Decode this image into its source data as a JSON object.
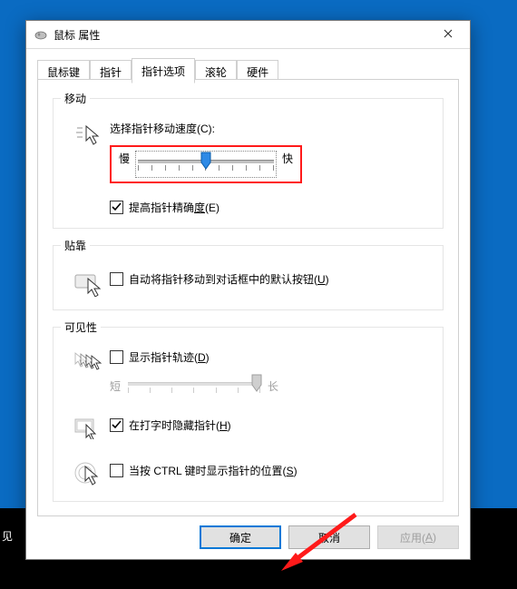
{
  "window": {
    "title": "鼠标 属性"
  },
  "tabs": [
    {
      "id": "buttons",
      "label": "鼠标键"
    },
    {
      "id": "pointer",
      "label": "指针"
    },
    {
      "id": "options",
      "label": "指针选项",
      "active": true
    },
    {
      "id": "wheel",
      "label": "滚轮"
    },
    {
      "id": "hardware",
      "label": "硬件"
    }
  ],
  "groups": {
    "motion": {
      "legend": "移动",
      "speed_label": "选择指针移动速度(C):",
      "slow": "慢",
      "fast": "快",
      "speed_value": 6,
      "speed_min": 1,
      "speed_max": 11,
      "enhance": {
        "checked": true,
        "label": "提高指针精确度(E)"
      }
    },
    "snap": {
      "legend": "贴靠",
      "snap": {
        "checked": false,
        "label": "自动将指针移动到对话框中的默认按钮(U)"
      }
    },
    "visibility": {
      "legend": "可见性",
      "trails": {
        "checked": false,
        "label": "显示指针轨迹(D)"
      },
      "trails_short": "短",
      "trails_long": "长",
      "trails_enabled": false,
      "hide_typing": {
        "checked": true,
        "label": "在打字时隐藏指针(H)"
      },
      "ctrl_locate": {
        "checked": false,
        "label": "当按 CTRL 键时显示指针的位置(S)"
      }
    }
  },
  "buttons": {
    "ok": "确定",
    "cancel": "取消",
    "apply": "应用(A)"
  },
  "backdrop_label": "见"
}
